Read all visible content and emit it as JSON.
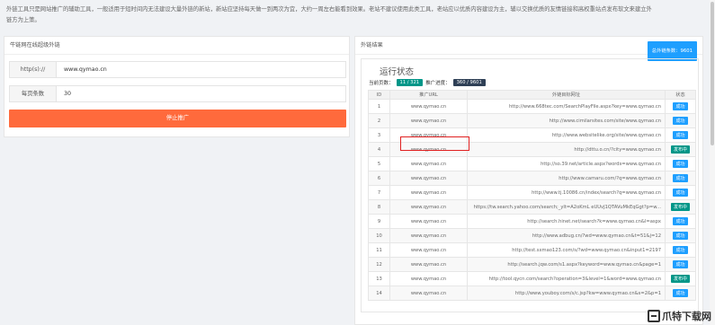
{
  "intro": "外链工具只是网站推广的辅助工具，一般适用于短时间内无法建设大量外链的新站，新站应坚持每天做一到两次为宜，大约一周左右能看到效果。老站不建议使用此类工具，老站应以优质内容建设为主，辅以交换优质的友情链接和高权重站点发布软文来建立外链方为上策。",
  "left_panel": {
    "title": "牛链网在线超级外链",
    "http_label": "http(s)://",
    "http_value": "www.qymao.cn",
    "per_page_label": "每页条数",
    "per_page_value": "30",
    "stop_button": "停止推广"
  },
  "right_panel": {
    "title": "外链结果",
    "total_badge": "总外链条数：9601",
    "status_title": "运行状态",
    "current_page_label": "当前页数：",
    "current_page_value": "11 / 321",
    "progress_label": "推广进度：",
    "progress_value": "360 / 9601",
    "columns": [
      "ID",
      "推广URL",
      "外链目标网址",
      "状态"
    ],
    "rows": [
      {
        "id": "1",
        "url": "www.qymao.cn",
        "target": "http://www.668tec.com/SearchPlayFile.aspx?key=www.qymao.cn",
        "status": "成功",
        "kind": "ok"
      },
      {
        "id": "2",
        "url": "www.qymao.cn",
        "target": "http://www.cimilarsites.com/site/www.qymao.cn",
        "status": "成功",
        "kind": "ok"
      },
      {
        "id": "3",
        "url": "www.qymao.cn",
        "target": "http://www.websitelike.org/site/www.qymao.cn",
        "status": "成功",
        "kind": "ok"
      },
      {
        "id": "4",
        "url": "www.qymao.cn",
        "target": "http://dttu.o.cn/?city=www.qymao.cn",
        "status": "发布中",
        "kind": "sending"
      },
      {
        "id": "5",
        "url": "www.qymao.cn",
        "target": "http://so.39.net/article.aspx?words=www.qymao.cn",
        "status": "成功",
        "kind": "ok"
      },
      {
        "id": "6",
        "url": "www.qymao.cn",
        "target": "http://www.camaru.com/?q=www.qymao.cn",
        "status": "成功",
        "kind": "ok"
      },
      {
        "id": "7",
        "url": "www.qymao.cn",
        "target": "http://www.tj.10086.cn/index/search?q=www.qymao.cn",
        "status": "成功",
        "kind": "ok"
      },
      {
        "id": "8",
        "url": "www.qymao.cn",
        "target": "https://tw.search.yahoo.com/search;_ylt=A2oKmL eUUvJ1QTAVuMkEqGgt?p=w...",
        "status": "发布中",
        "kind": "sending"
      },
      {
        "id": "9",
        "url": "www.qymao.cn",
        "target": "http://search.hinet.net/search?k=www.qymao.cn&l=aspx",
        "status": "成功",
        "kind": "ok"
      },
      {
        "id": "10",
        "url": "www.qymao.cn",
        "target": "http://www.adbug.cn/?wd=www.qymao.cn&t=51&j=12",
        "status": "成功",
        "kind": "ok"
      },
      {
        "id": "11",
        "url": "www.qymao.cn",
        "target": "http://test.sxmao123.com/s/?wd=www.qymao.cn&input1=2197",
        "status": "成功",
        "kind": "ok"
      },
      {
        "id": "12",
        "url": "www.qymao.cn",
        "target": "http://search.jqw.com/s1.aspx?keyword=www.qymao.cn&page=1",
        "status": "成功",
        "kind": "ok"
      },
      {
        "id": "13",
        "url": "www.qymao.cn",
        "target": "http://tool.qycn.com/search?operation=3&level=1&word=www.qymao.cn",
        "status": "发布中",
        "kind": "sending"
      },
      {
        "id": "14",
        "url": "www.qymao.cn",
        "target": "http://www.youboy.com/s/c.jsp?kw=www.qymao.cn&s=2&p=1",
        "status": "成功",
        "kind": "ok"
      }
    ]
  },
  "watermark": "爪特下载网",
  "colors": {
    "stop_button": "#ff6a3c",
    "ok": "#1e9fff",
    "sending": "#009688",
    "highlight": "#e02020"
  }
}
